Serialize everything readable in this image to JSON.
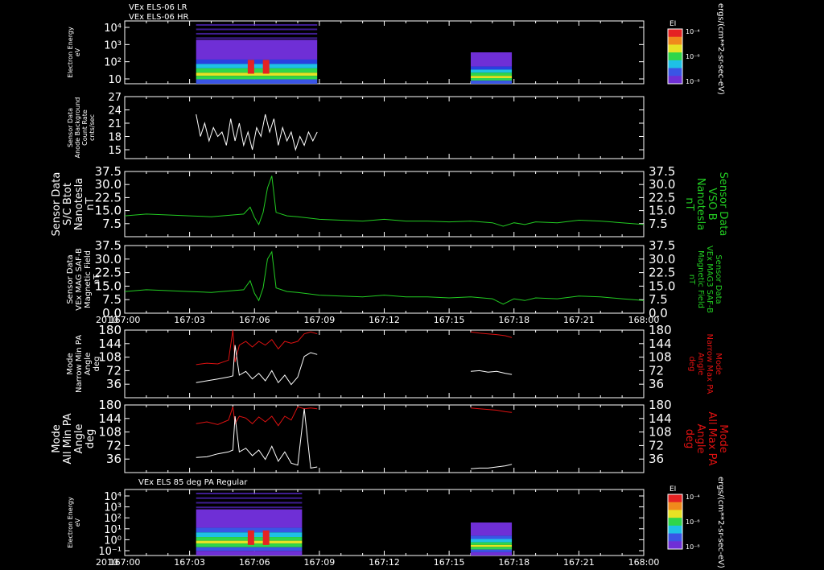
{
  "header": {
    "line1": "VEx ELS-06 LR",
    "line2": "VEx ELS-06 HR"
  },
  "colors": {
    "white": "#ffffff",
    "green": "#22cc22",
    "red": "#dd1111",
    "frame": "#ffffff",
    "background": "#000000"
  },
  "colorbar": {
    "label": "EI",
    "units": "ergs/(cm**2-sr-sec-eV)",
    "ticks": [
      "10⁻⁴",
      "10⁻⁶",
      "10⁻⁸"
    ]
  },
  "spectro_label": "VEx ELS 85 deg PA Regular",
  "time_axis": {
    "year": "2010",
    "ticks": [
      "167:00",
      "167:03",
      "167:06",
      "167:09",
      "167:12",
      "167:15",
      "167:18",
      "167:21",
      "168:00"
    ]
  },
  "chart_data": [
    {
      "type": "heatmap",
      "ylabel_lines": [
        "Electron Energy",
        "eV"
      ],
      "yticks": [
        "10⁴",
        "10³",
        "10²",
        "10"
      ],
      "notes": "Energy spectrogram; data from ~167:03.3 to 167:08.9 and 167:16.0 to 167:17.9"
    },
    {
      "type": "line",
      "ylabel_lines": [
        "Sensor Data",
        "Anode Background",
        "Count Rate",
        "cnts/sec"
      ],
      "yticks": [
        "27",
        "24",
        "21",
        "18",
        "15"
      ],
      "ylim": [
        13,
        27
      ],
      "series": [
        {
          "color": "#ffffff",
          "x": [
            3.3,
            3.5,
            3.7,
            3.9,
            4.1,
            4.3,
            4.5,
            4.7,
            4.9,
            5.1,
            5.3,
            5.5,
            5.7,
            5.9,
            6.1,
            6.3,
            6.5,
            6.7,
            6.9,
            7.1,
            7.3,
            7.5,
            7.7,
            7.9,
            8.1,
            8.3,
            8.5,
            8.7,
            8.9
          ],
          "y": [
            23,
            18,
            21,
            17,
            20,
            18,
            19,
            16,
            22,
            17,
            21,
            16,
            19,
            15,
            20,
            18,
            23,
            19,
            22,
            16,
            20,
            17,
            19,
            15,
            18,
            16,
            19,
            17,
            19
          ]
        }
      ]
    },
    {
      "type": "line",
      "ylabel_lines": [
        "Sensor Data",
        "S/C Btot",
        "Nanotesla",
        "nT"
      ],
      "ylabel_right_lines": [
        "Sensor Data",
        "VSO B",
        "Nanotesla",
        "nT"
      ],
      "yticks": [
        "37.5",
        "30.0",
        "22.5",
        "15.0",
        "7.5"
      ],
      "ylim": [
        0,
        37.5
      ],
      "series": [
        {
          "color": "#22cc22",
          "x": [
            0,
            1,
            2,
            3,
            4,
            4.5,
            5,
            5.5,
            5.8,
            6.0,
            6.2,
            6.4,
            6.6,
            6.8,
            7.0,
            7.5,
            8,
            9,
            10,
            11,
            12,
            13,
            14,
            15,
            16,
            17,
            17.5,
            18,
            18.5,
            19,
            20,
            21,
            22,
            23,
            24
          ],
          "y": [
            12,
            13,
            12.5,
            12,
            11.5,
            12,
            12.5,
            13,
            17,
            11,
            7,
            14,
            28,
            35,
            14,
            12,
            11.5,
            10,
            9.5,
            9,
            10,
            9,
            9,
            8.5,
            9,
            8,
            6,
            8,
            7,
            8.5,
            8,
            9.5,
            9,
            8,
            7
          ]
        }
      ]
    },
    {
      "type": "line",
      "ylabel_lines": [
        "Sensor Data",
        "VEx MAG SAF-B",
        "Magnetic Field",
        "nT"
      ],
      "ylabel_right_lines": [
        "Sensor Data",
        "VEx MAG3 SAF-B",
        "Magnetic Field",
        "nT"
      ],
      "yticks": [
        "37.5",
        "30.0",
        "22.5",
        "15.0",
        "7.5",
        "0.0"
      ],
      "ylim": [
        0,
        37.5
      ],
      "series": [
        {
          "color": "#22cc22",
          "x": [
            0,
            1,
            2,
            3,
            4,
            4.5,
            5,
            5.5,
            5.8,
            6.0,
            6.2,
            6.4,
            6.6,
            6.8,
            7.0,
            7.5,
            8,
            9,
            10,
            11,
            12,
            13,
            14,
            15,
            16,
            17,
            17.5,
            18,
            18.5,
            19,
            20,
            21,
            22,
            23,
            24
          ],
          "y": [
            12,
            13,
            12.5,
            12,
            11.5,
            12,
            12.5,
            13,
            18,
            11,
            7,
            14,
            30,
            34,
            14,
            12,
            11.5,
            10,
            9.5,
            9,
            10,
            9,
            9,
            8.5,
            9,
            8,
            5,
            8,
            7,
            8.5,
            8,
            9.5,
            9,
            8,
            7
          ]
        }
      ]
    },
    {
      "type": "line",
      "ylabel_lines": [
        "Mode",
        "Narrow Min PA",
        "Angle",
        "deg"
      ],
      "ylabel_right_lines": [
        "Mode",
        "Narrow Max PA",
        "Angle",
        "deg"
      ],
      "yticks": [
        "180",
        "144",
        "108",
        "72",
        "36"
      ],
      "ylim": [
        0,
        180
      ],
      "series": [
        {
          "name": "Max PA",
          "color": "#dd1111",
          "x": [
            3.3,
            3.8,
            4.3,
            4.8,
            5.0,
            5.1,
            5.3,
            5.6,
            5.9,
            6.2,
            6.5,
            6.8,
            7.1,
            7.4,
            7.7,
            8.0,
            8.3,
            8.6,
            8.9
          ],
          "y": [
            88,
            92,
            90,
            100,
            180,
            95,
            140,
            150,
            135,
            150,
            140,
            155,
            130,
            150,
            145,
            150,
            170,
            175,
            170
          ]
        },
        {
          "name": "Min PA",
          "color": "#ffffff",
          "x": [
            3.3,
            3.8,
            4.3,
            4.8,
            5.0,
            5.1,
            5.3,
            5.6,
            5.9,
            6.2,
            6.5,
            6.8,
            7.1,
            7.4,
            7.7,
            8.0,
            8.3,
            8.6,
            8.9
          ],
          "y": [
            40,
            45,
            50,
            55,
            58,
            140,
            60,
            70,
            50,
            65,
            45,
            72,
            40,
            60,
            35,
            55,
            110,
            120,
            115
          ]
        },
        {
          "name": "Max PA 2",
          "color": "#dd1111",
          "x": [
            16.0,
            16.4,
            16.8,
            17.2,
            17.6,
            17.9
          ],
          "y": [
            175,
            172,
            170,
            168,
            165,
            160
          ]
        },
        {
          "name": "Min PA 2",
          "color": "#ffffff",
          "x": [
            16.0,
            16.4,
            16.8,
            17.2,
            17.6,
            17.9
          ],
          "y": [
            70,
            72,
            68,
            70,
            65,
            62
          ]
        }
      ]
    },
    {
      "type": "line",
      "ylabel_lines": [
        "Mode",
        "All Min PA",
        "Angle",
        "deg"
      ],
      "ylabel_right_lines": [
        "Mode",
        "All Max PA",
        "Angle",
        "deg"
      ],
      "yticks": [
        "180",
        "144",
        "108",
        "72",
        "36"
      ],
      "ylim": [
        0,
        180
      ],
      "series": [
        {
          "name": "Max PA",
          "color": "#dd1111",
          "x": [
            3.3,
            3.8,
            4.3,
            4.8,
            5.0,
            5.1,
            5.3,
            5.6,
            5.9,
            6.2,
            6.5,
            6.8,
            7.1,
            7.4,
            7.7,
            8.0,
            8.3,
            8.6,
            8.9
          ],
          "y": [
            130,
            135,
            128,
            140,
            175,
            130,
            150,
            145,
            130,
            148,
            135,
            150,
            125,
            150,
            140,
            175,
            170,
            172,
            170
          ]
        },
        {
          "name": "Min PA",
          "color": "#ffffff",
          "x": [
            3.3,
            3.8,
            4.3,
            4.8,
            5.0,
            5.1,
            5.3,
            5.6,
            5.9,
            6.2,
            6.5,
            6.8,
            7.1,
            7.4,
            7.7,
            8.0,
            8.3,
            8.6,
            8.9
          ],
          "y": [
            40,
            42,
            50,
            55,
            60,
            150,
            55,
            65,
            45,
            60,
            35,
            70,
            30,
            55,
            25,
            20,
            170,
            12,
            15
          ]
        },
        {
          "name": "Max PA 2",
          "color": "#dd1111",
          "x": [
            16.0,
            16.4,
            16.8,
            17.2,
            17.6,
            17.9
          ],
          "y": [
            172,
            170,
            168,
            166,
            162,
            160
          ]
        },
        {
          "name": "Min PA 2",
          "color": "#ffffff",
          "x": [
            16.0,
            16.4,
            16.8,
            17.2,
            17.6,
            17.9
          ],
          "y": [
            10,
            12,
            12,
            15,
            18,
            22
          ]
        }
      ]
    },
    {
      "type": "heatmap",
      "ylabel_lines": [
        "Electron Energy",
        "eV"
      ],
      "yticks": [
        "10⁴",
        "10³",
        "10²",
        "10¹",
        "10⁰",
        "10⁻¹"
      ],
      "notes": "Energy spectrogram 85 deg PA; data from ~167:03.3 to 167:08.2 and 167:16.0 to 167:17.9"
    }
  ]
}
